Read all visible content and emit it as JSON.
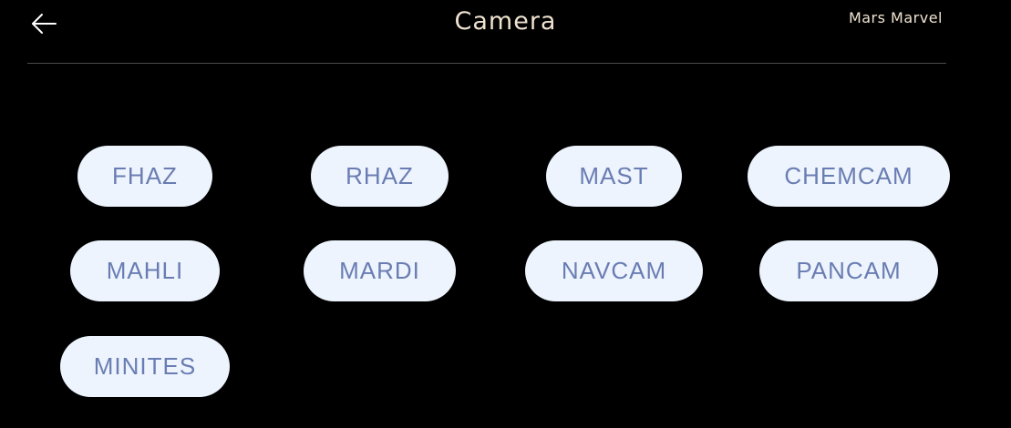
{
  "header": {
    "back_icon": "arrow-left-icon",
    "title": "Camera",
    "brand": "Mars Marvel"
  },
  "cameras": [
    {
      "label": "FHAZ"
    },
    {
      "label": "RHAZ"
    },
    {
      "label": "MAST"
    },
    {
      "label": "CHEMCAM"
    },
    {
      "label": "MAHLI"
    },
    {
      "label": "MARDI"
    },
    {
      "label": "NAVCAM"
    },
    {
      "label": "PANCAM"
    },
    {
      "label": "MINITES"
    }
  ],
  "colors": {
    "background": "#000000",
    "header_text": "#efe3cf",
    "button_bg": "#edf4fd",
    "button_text": "#6a7db3",
    "divider": "#4a4a4a"
  }
}
